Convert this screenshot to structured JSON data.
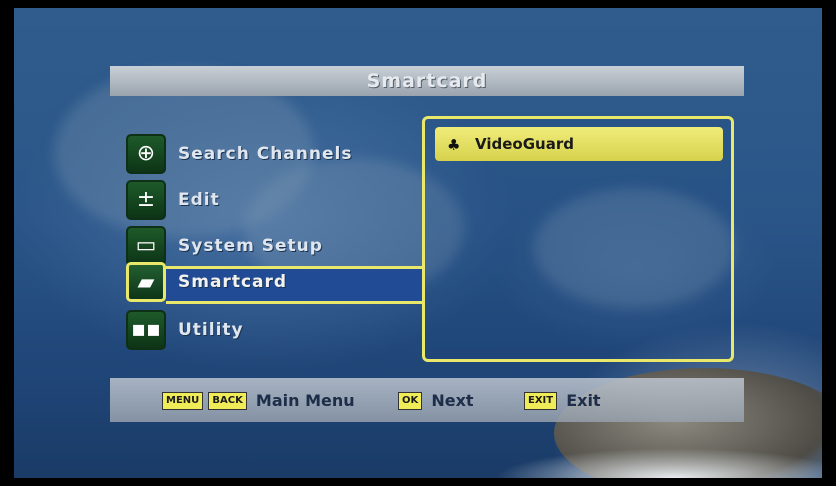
{
  "screen_title": "Smartcard",
  "menu": [
    {
      "label": "Search Channels",
      "icon": "search-plus-icon",
      "glyph": "⊕"
    },
    {
      "label": "Edit",
      "icon": "edit-list-icon",
      "glyph": "±"
    },
    {
      "label": "System Setup",
      "icon": "monitor-icon",
      "glyph": "▭"
    },
    {
      "label": "Smartcard",
      "icon": "smartcard-icon",
      "glyph": "▰",
      "selected": true
    },
    {
      "label": "Utility",
      "icon": "utility-icon",
      "glyph": "▪▪"
    }
  ],
  "submenu": {
    "items": [
      {
        "label": "VideoGuard",
        "icon": "card-icon"
      }
    ]
  },
  "hints": {
    "menu_key": "MENU",
    "back_key": "BACK",
    "main_menu_label": "Main Menu",
    "ok_key": "OK",
    "next_label": "Next",
    "exit_key": "EXIT",
    "exit_label": "Exit"
  },
  "colors": {
    "highlight": "#e9e86a",
    "selection_blue": "#214c95",
    "icon_green": "#1e5a2a"
  }
}
